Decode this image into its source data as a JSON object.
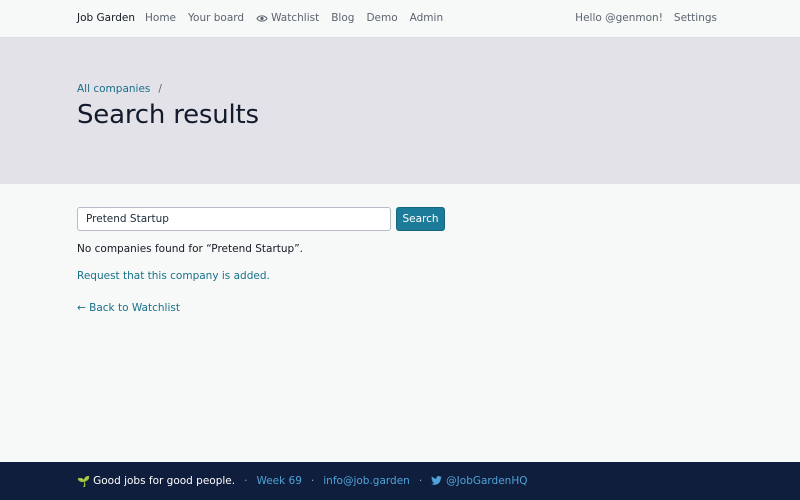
{
  "nav": {
    "brand": "Job Garden",
    "links": [
      "Home",
      "Your board",
      "Watchlist",
      "Blog",
      "Demo",
      "Admin"
    ],
    "greeting": "Hello @genmon!",
    "settings": "Settings"
  },
  "hero": {
    "breadcrumb": {
      "link": "All companies",
      "separator": "/"
    },
    "title": "Search results"
  },
  "search": {
    "value": "Pretend Startup",
    "button_label": "Search"
  },
  "results": {
    "message": "No companies found for “Pretend Startup”.",
    "request_link": "Request that this company is added.",
    "back_link": "← Back to Watchlist"
  },
  "footer": {
    "tagline": "Good jobs for good people.",
    "week": "Week 69",
    "email": "info@job.garden",
    "twitter": "@JobGardenHQ",
    "separator": "·"
  },
  "colors": {
    "accent": "#1b7b98",
    "link": "#1a6f8a",
    "hero_bg": "#e3e2e8",
    "footer_bg": "#0f1e3c"
  }
}
